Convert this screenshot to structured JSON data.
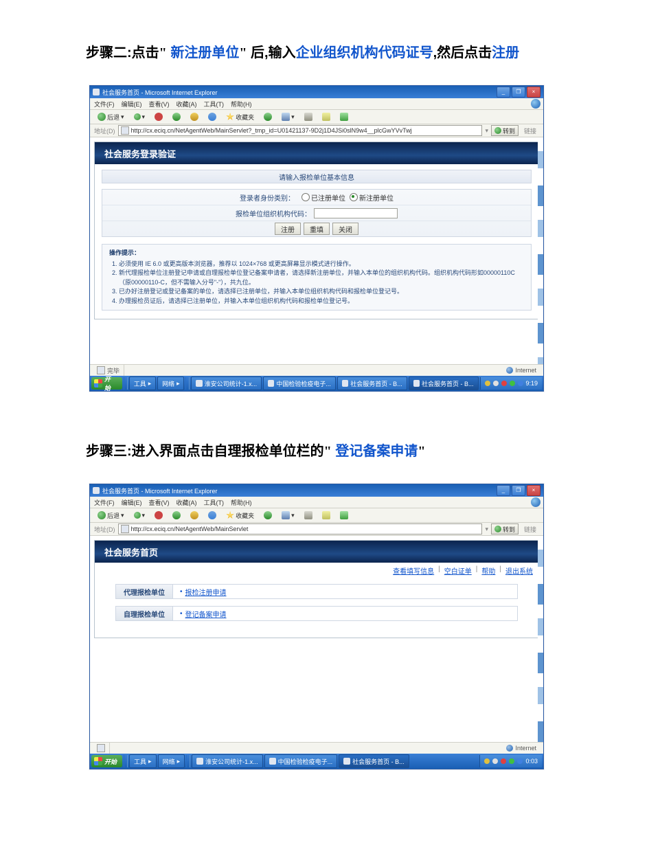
{
  "step2": {
    "prefix": "步骤二:点击",
    "quote_open": "\"",
    "hl1": "新注册单位",
    "quote_close": "\"",
    "mid1": "后,输入",
    "hl2": "企业组织机构代码证号",
    "mid2": ",然后点击",
    "hl3": "注册"
  },
  "step3": {
    "prefix": "步骤三:进入界面点击自理报检单位栏的",
    "quote_open": "\"",
    "hl1": "登记备案申请",
    "quote_close": "\""
  },
  "browser1": {
    "title": "社会服务首页 - Microsoft Internet Explorer",
    "menu": [
      "文件(F)",
      "编辑(E)",
      "查看(V)",
      "收藏(A)",
      "工具(T)",
      "帮助(H)"
    ],
    "toolbar": {
      "back": "后退",
      "fav": "收藏夹"
    },
    "addr_label": "地址(D)",
    "url": "http://cx.eciq.cn/NetAgentWeb/MainServlet?_tmp_id=U01421137-9D2j1D4JSi0slN9w4__plcGwYVvTwj",
    "go": "转到",
    "links": "链接",
    "app_title": "社会服务登录验证",
    "notice": "请输入报检单位基本信息",
    "form": {
      "row1_label": "登录者身份类别：",
      "radio1": "已注册单位",
      "radio2": "新注册单位",
      "row2_label": "报检单位组织机构代码：",
      "btn_register": "注册",
      "btn_reset": "重填",
      "btn_close": "关闭"
    },
    "tips_title": "操作提示：",
    "tips": [
      "必须使用 IE 6.0 或更高版本浏览器，推荐以 1024×768 或更高屏幕显示模式进行操作。",
      "新代理报检单位注册登记申请或自理报检单位登记备案申请者，请选择新注册单位，并输入本单位的组织机构代码。组织机构代码形如00000110C（原00000110-C，但不需输入分号\"-\"），共九位。",
      "已办好注册登记或登记备案的单位，请选择已注册单位，并输入本单位组织机构代码和报检单位登记号。",
      "办理报检员证后，请选择已注册单位，并输入本单位组织机构代码和报检单位登记号。"
    ],
    "status_left": "完毕",
    "status_right": "Internet",
    "taskbar": {
      "start": "开始",
      "group1": "工具",
      "group2": "网络",
      "tasks": [
        "淮安公司统计-1.x...",
        "中国检验检疫电子...",
        "社会服务首页 - B...",
        "社会服务首页 - B..."
      ],
      "time": "9:19"
    }
  },
  "browser2": {
    "title": "社会服务首页 - Microsoft Internet Explorer",
    "menu": [
      "文件(F)",
      "编辑(E)",
      "查看(V)",
      "收藏(A)",
      "工具(T)",
      "帮助(H)"
    ],
    "toolbar": {
      "back": "后退",
      "fav": "收藏夹"
    },
    "addr_label": "地址(D)",
    "url": "http://cx.eciq.cn/NetAgentWeb/MainServlet",
    "go": "转到",
    "links": "链接",
    "app_title": "社会服务首页",
    "toplinks": [
      "查看填写信息",
      "空白证单",
      "帮助",
      "退出系统"
    ],
    "row1_label": "代理报检单位",
    "row1_link": "报检注册申请",
    "row2_label": "自理报检单位",
    "row2_link": "登记备案申请",
    "status_right": "Internet",
    "taskbar": {
      "start": "开始",
      "group1": "工具",
      "group2": "网络",
      "tasks": [
        "淮安公司统计-1.x...",
        "中国检验检疫电子...",
        "社会服务首页 - B..."
      ],
      "time": "0:03"
    }
  }
}
